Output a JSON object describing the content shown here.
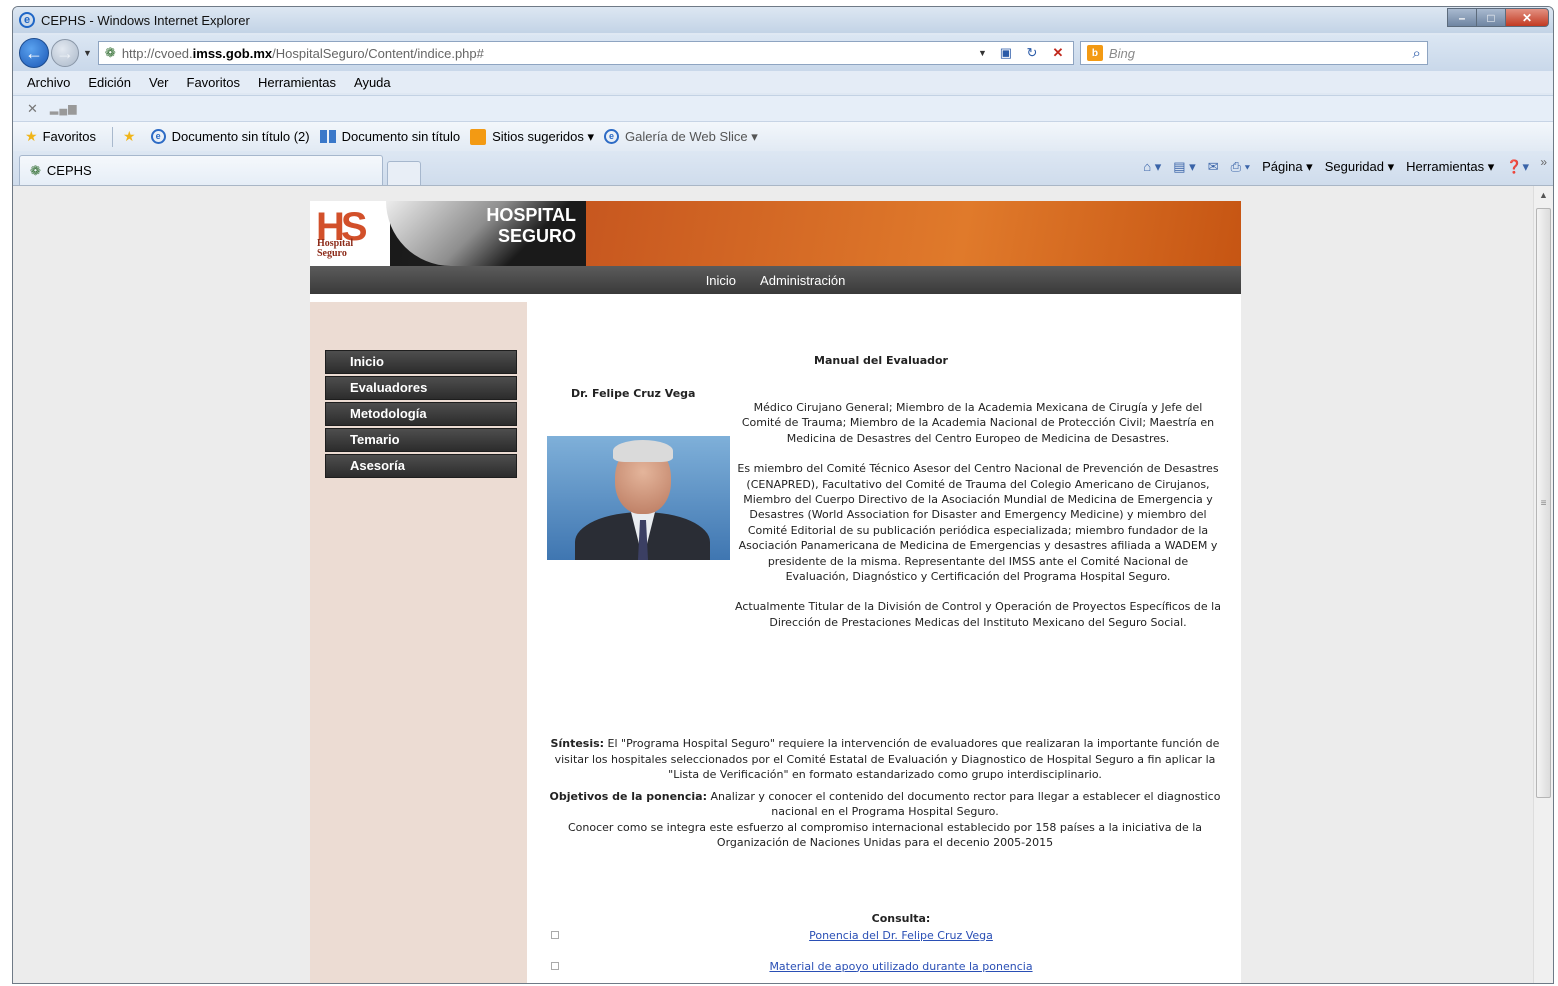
{
  "window": {
    "title": "CEPHS - Windows Internet Explorer",
    "controls": [
      "–",
      "□",
      "✕"
    ]
  },
  "address": {
    "url_prefix": "http://cvoed.",
    "url_domain": "imss.gob.mx",
    "url_path": "/HospitalSeguro/Content/indice.php#",
    "search_placeholder": "Bing"
  },
  "menubar": {
    "items": [
      "Archivo",
      "Edición",
      "Ver",
      "Favoritos",
      "Herramientas",
      "Ayuda"
    ]
  },
  "cmdline": {
    "close": "✕",
    "bars": "▂▄▆"
  },
  "favbar": {
    "favorites_label": "Favoritos",
    "links": [
      {
        "label": "Documento sin título (2)"
      },
      {
        "label": "Documento sin título"
      },
      {
        "label": "Sitios sugeridos ▾"
      },
      {
        "label": "Galería de Web Slice ▾"
      }
    ]
  },
  "tabs": {
    "active": "CEPHS"
  },
  "commandbar": {
    "items": [
      "Página ▾",
      "Seguridad ▾",
      "Herramientas ▾"
    ]
  },
  "site": {
    "brand_line1": "HOSPITAL",
    "brand_line2": "SEGURO",
    "logo_letters": "HS",
    "logo_sub1": "Hospital",
    "logo_sub2": "Seguro",
    "nav": [
      "Inicio",
      "Administración"
    ],
    "sidebar": [
      "Inicio",
      "Evaluadores",
      "Metodología",
      "Temario",
      "Asesoría"
    ]
  },
  "content": {
    "title": "Manual del Evaluador",
    "author": "Dr. Felipe Cruz Vega",
    "bio": [
      "Médico Cirujano General; Miembro de la Academia Mexicana de Cirugía y Jefe del Comité de Trauma; Miembro de la Academia Nacional de Protección Civil; Maestría en Medicina de Desastres del Centro Europeo de Medicina de Desastres.",
      "Es miembro del Comité Técnico Asesor del Centro Nacional de Prevención de Desastres (CENAPRED), Facultativo del Comité de Trauma del Colegio Americano de Cirujanos, Miembro del Cuerpo Directivo de la Asociación Mundial de Medicina de Emergencia y Desastres (World Association for Disaster and Emergency Medicine) y miembro del Comité Editorial de su publicación periódica especializada; miembro fundador de la Asociación Panamericana de Medicina de Emergencias y desastres afiliada a WADEM y presidente de la misma. Representante del IMSS ante el Comité Nacional de Evaluación, Diagnóstico y Certificación del Programa Hospital Seguro.",
      "Actualmente Titular de la División de Control y Operación de Proyectos Específicos de la Dirección de Prestaciones Medicas del Instituto Mexicano del Seguro Social."
    ],
    "synthesis_label": "Síntesis:",
    "synthesis_text": " El \"Programa Hospital Seguro\" requiere la intervención de evaluadores que realizaran la importante función de visitar los hospitales seleccionados por el Comité Estatal de Evaluación y Diagnostico de Hospital Seguro a fin aplicar la \"Lista de Verificación\" en formato estandarizado como grupo interdisciplinario.",
    "objectives_label": "Objetivos de la ponencia:",
    "objectives_text": " Analizar y conocer el contenido del documento rector para llegar a establecer el diagnostico nacional en el Programa Hospital Seguro.",
    "objectives_text2": "Conocer como se integra este esfuerzo al compromiso internacional establecido por 158 países a la iniciativa de la Organización de Naciones Unidas para el decenio 2005-2015",
    "consulta_label": "Consulta:",
    "links": [
      "Ponencia del Dr. Felipe Cruz Vega",
      "Material de apoyo utilizado durante la ponencia"
    ]
  }
}
